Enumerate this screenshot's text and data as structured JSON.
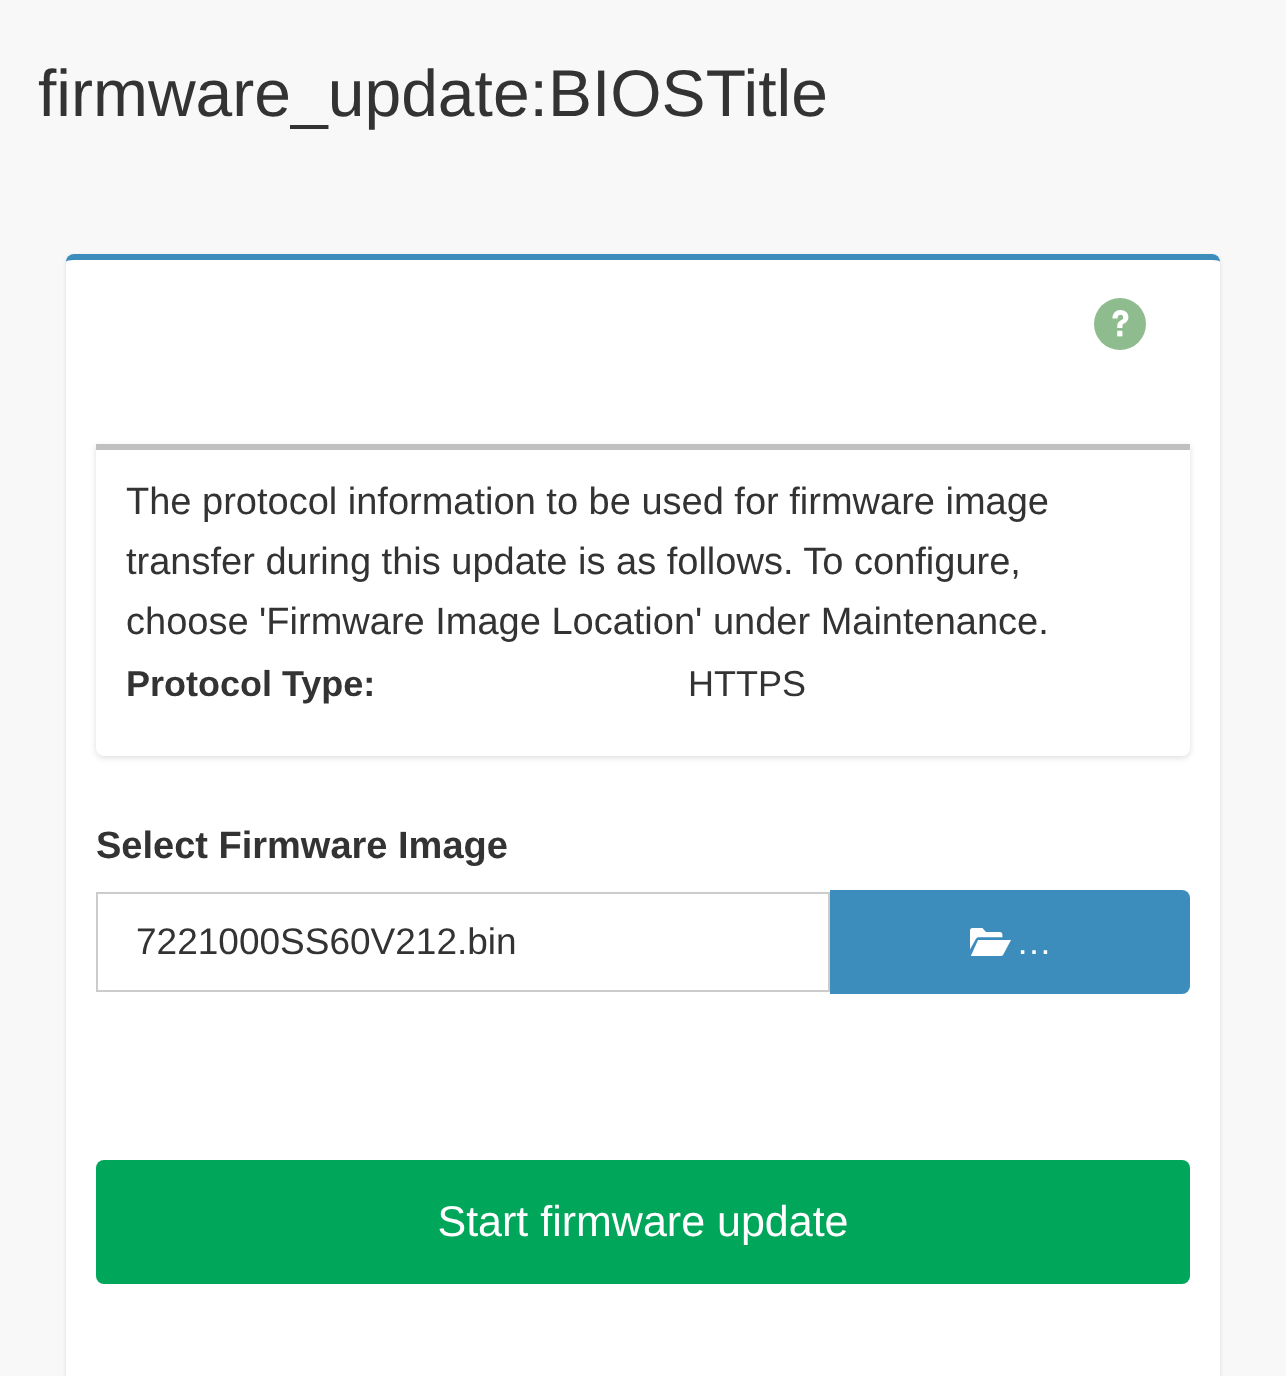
{
  "page_title": "firmware_update:BIOSTitle",
  "info": {
    "text": "The protocol information to be used for firmware image transfer during this update is as follows. To configure, choose 'Firmware Image Location' under Maintenance.",
    "protocol_label": "Protocol Type:",
    "protocol_value": "HTTPS"
  },
  "file_select": {
    "label": "Select Firmware Image",
    "value": "7221000SS60V212.bin",
    "browse_label": "…"
  },
  "submit_button": "Start firmware update"
}
